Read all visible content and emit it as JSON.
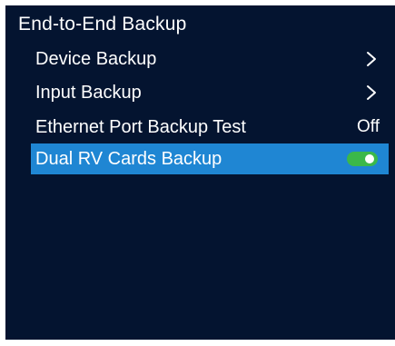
{
  "screen": {
    "title": "End-to-End Backup",
    "background_color": "#041430",
    "highlight_color": "#1f86d3",
    "toggle_on_color": "#3bb84a"
  },
  "menu": {
    "items": [
      {
        "label": "Device Backup",
        "trailing": "chevron-right-icon"
      },
      {
        "label": "Input Backup",
        "trailing": "chevron-right-icon"
      },
      {
        "label": "Ethernet Port Backup Test",
        "value": "Off"
      },
      {
        "label": "Dual RV Cards Backup",
        "toggle": "on",
        "selected": true
      }
    ]
  }
}
